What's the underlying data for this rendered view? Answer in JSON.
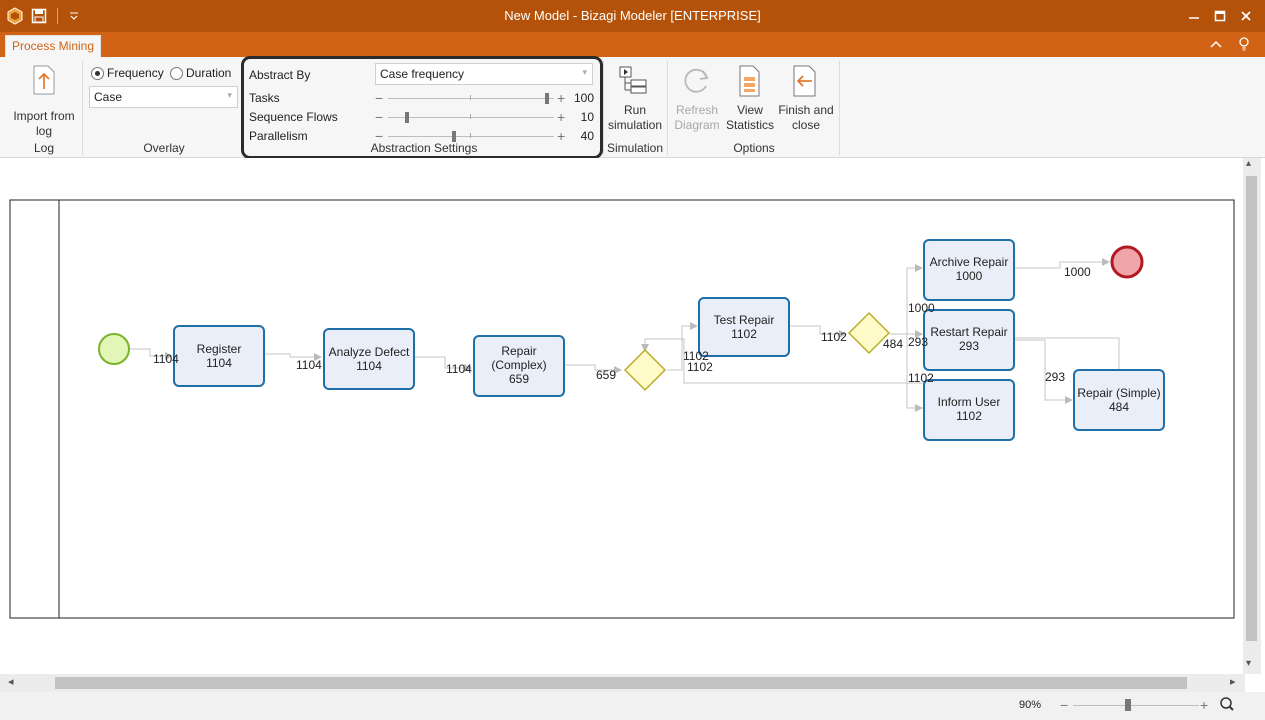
{
  "window": {
    "title": "New Model - Bizagi Modeler [ENTERPRISE]"
  },
  "tabs": [
    "Process Mining"
  ],
  "ribbon": {
    "log": {
      "import_label_1": "Import from",
      "import_label_2": "log",
      "group_label": "Log"
    },
    "overlay": {
      "frequency_label": "Frequency",
      "duration_label": "Duration",
      "selected": "Frequency",
      "case_value": "Case",
      "group_label": "Overlay"
    },
    "abstraction": {
      "abstract_by_label": "Abstract By",
      "abstract_by_value": "Case frequency",
      "tasks_label": "Tasks",
      "tasks_value": "100",
      "sequence_flows_label": "Sequence Flows",
      "sequence_flows_value": "10",
      "parallelism_label": "Parallelism",
      "parallelism_value": "40",
      "group_label": "Abstraction Settings"
    },
    "simulation": {
      "run_label_1": "Run",
      "run_label_2": "simulation",
      "group_label": "Simulation"
    },
    "options": {
      "refresh_label_1": "Refresh",
      "refresh_label_2": "Diagram",
      "statistics_label_1": "View",
      "statistics_label_2": "Statistics",
      "finish_label_1": "Finish and",
      "finish_label_2": "close",
      "group_label": "Options"
    }
  },
  "diagram": {
    "tasks": [
      {
        "id": "register",
        "name": "Register",
        "count": "1104"
      },
      {
        "id": "analyze",
        "name": "Analyze Defect",
        "count": "1104"
      },
      {
        "id": "repair-complex",
        "name1": "Repair",
        "name2": "(Complex)",
        "count": "659"
      },
      {
        "id": "test-repair",
        "name": "Test Repair",
        "count": "1102"
      },
      {
        "id": "archive-repair",
        "name": "Archive Repair",
        "count": "1000"
      },
      {
        "id": "restart-repair",
        "name": "Restart Repair",
        "count": "293"
      },
      {
        "id": "inform-user",
        "name": "Inform User",
        "count": "1102"
      },
      {
        "id": "repair-simple",
        "name": "Repair (Simple)",
        "count": "484"
      }
    ],
    "flow_labels": [
      "1104",
      "1104",
      "1104",
      "659",
      "1102",
      "1102",
      "1102",
      "484",
      "293",
      "1000",
      "1102",
      "1000",
      "293"
    ]
  },
  "status": {
    "zoom": "90%"
  },
  "colors": {
    "accent": "#d06315",
    "title_bg": "#b4520a",
    "task_fill": "#eaeef8",
    "task_border": "#1e6ea8"
  }
}
